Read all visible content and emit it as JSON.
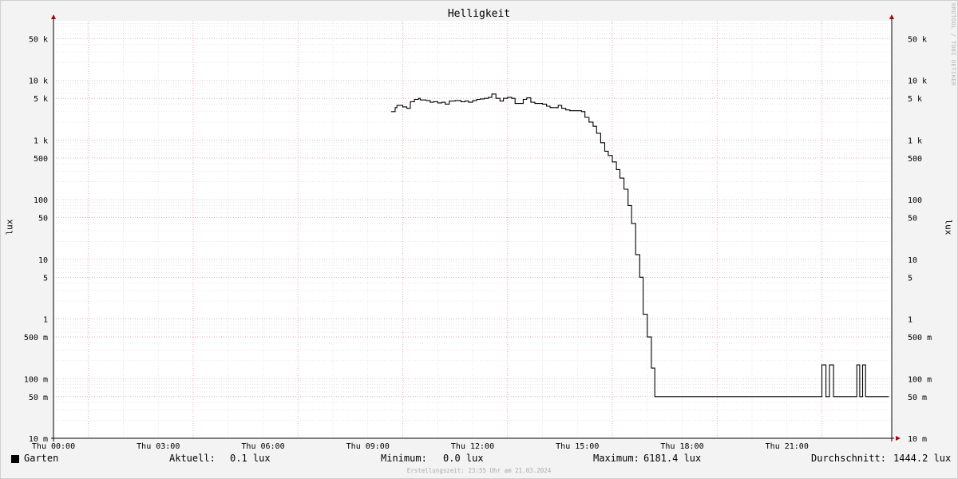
{
  "watermark": "RRDTOOL / TOBI OETIKER",
  "chart_data": {
    "type": "line",
    "title": "Helligkeit",
    "ylabel": "lux",
    "y_scale": "log",
    "ylim": [
      0.01,
      100000
    ],
    "grid": true,
    "y_ticks": [
      {
        "value": 0.01,
        "label": "10 m"
      },
      {
        "value": 0.05,
        "label": "50 m"
      },
      {
        "value": 0.1,
        "label": "100 m"
      },
      {
        "value": 0.5,
        "label": "500 m"
      },
      {
        "value": 1,
        "label": "1"
      },
      {
        "value": 5,
        "label": "5"
      },
      {
        "value": 10,
        "label": "10"
      },
      {
        "value": 50,
        "label": "50"
      },
      {
        "value": 100,
        "label": "100"
      },
      {
        "value": 500,
        "label": "500"
      },
      {
        "value": 1000,
        "label": "1 k"
      },
      {
        "value": 5000,
        "label": "5 k"
      },
      {
        "value": 10000,
        "label": "10 k"
      },
      {
        "value": 50000,
        "label": "50 k"
      }
    ],
    "xlim": [
      "00:00",
      "24:00"
    ],
    "x_ticks": [
      "Thu 00:00",
      "Thu 03:00",
      "Thu 06:00",
      "Thu 09:00",
      "Thu 12:00",
      "Thu 15:00",
      "Thu 18:00",
      "Thu 21:00"
    ],
    "series": [
      {
        "name": "Garten",
        "color": "#000000",
        "x": [
          "09:40",
          "09:47",
          "09:50",
          "10:00",
          "10:07",
          "10:13",
          "10:20",
          "10:27",
          "10:30",
          "10:40",
          "10:47",
          "10:53",
          "11:00",
          "11:07",
          "11:13",
          "11:20",
          "11:30",
          "11:40",
          "11:47",
          "11:53",
          "12:00",
          "12:07",
          "12:13",
          "12:20",
          "12:27",
          "12:33",
          "12:40",
          "12:47",
          "12:53",
          "13:00",
          "13:07",
          "13:13",
          "13:20",
          "13:27",
          "13:33",
          "13:40",
          "13:47",
          "13:53",
          "14:00",
          "14:07",
          "14:13",
          "14:20",
          "14:27",
          "14:33",
          "14:40",
          "14:47",
          "14:53",
          "15:00",
          "15:07",
          "15:13",
          "15:20",
          "15:27",
          "15:33",
          "15:40",
          "15:47",
          "15:53",
          "16:00",
          "16:07",
          "16:13",
          "16:20",
          "16:27",
          "16:33",
          "16:40",
          "16:47",
          "16:53",
          "17:00",
          "17:07",
          "17:13",
          "17:20",
          "17:27",
          "17:33",
          "17:40",
          "17:47",
          "17:53",
          "18:00",
          "18:07",
          "18:13",
          "18:20",
          "18:27",
          "18:33",
          "18:40",
          "18:47",
          "18:53",
          "19:00",
          "19:07",
          "19:13",
          "19:20",
          "19:27",
          "19:33",
          "19:40",
          "20:00",
          "20:30",
          "21:00",
          "21:30",
          "21:55",
          "22:00",
          "22:07",
          "22:13",
          "22:20",
          "22:30",
          "22:40",
          "22:55",
          "23:00",
          "23:05",
          "23:10",
          "23:15",
          "23:20",
          "23:30",
          "23:55"
        ],
        "values": [
          3000,
          3500,
          3800,
          3600,
          3400,
          4400,
          4800,
          5000,
          4700,
          4600,
          4300,
          4400,
          4200,
          4300,
          4000,
          4500,
          4600,
          4400,
          4500,
          4300,
          4600,
          4800,
          4900,
          5000,
          5200,
          5900,
          5000,
          4500,
          5000,
          5200,
          5000,
          4100,
          4100,
          4800,
          5100,
          4300,
          4100,
          4100,
          4000,
          3700,
          3500,
          3500,
          3800,
          3400,
          3200,
          3100,
          3100,
          3100,
          3000,
          2400,
          2000,
          1700,
          1300,
          900,
          650,
          550,
          430,
          320,
          230,
          150,
          80,
          40,
          12,
          5,
          1.2,
          0.5,
          0.15,
          0.05,
          0.05,
          0.05,
          0.05,
          0.05,
          0.05,
          0.05,
          0.05,
          0.05,
          0.05,
          0.05,
          0.05,
          0.05,
          0.05,
          0.05,
          0.05,
          0.05,
          0.05,
          0.05,
          0.05,
          0.05,
          0.05,
          0.05,
          0.05,
          0.05,
          0.05,
          0.05,
          0.05,
          0.17,
          0.05,
          0.17,
          0.05,
          0.05,
          0.05,
          0.05,
          0.17,
          0.05,
          0.17,
          0.05,
          0.05,
          0.05,
          0.05
        ]
      }
    ]
  },
  "legend": {
    "name": "Garten",
    "current_label": "Aktuell:",
    "current_value": "0.1 lux",
    "min_label": "Minimum:",
    "min_value": "0.0 lux",
    "max_label": "Maximum:",
    "max_value": "6181.4 lux",
    "avg_label": "Durchschnitt:",
    "avg_value": "1444.2 lux"
  },
  "footer": "Erstellungszeit: 23:55 Uhr am 21.03.2024"
}
